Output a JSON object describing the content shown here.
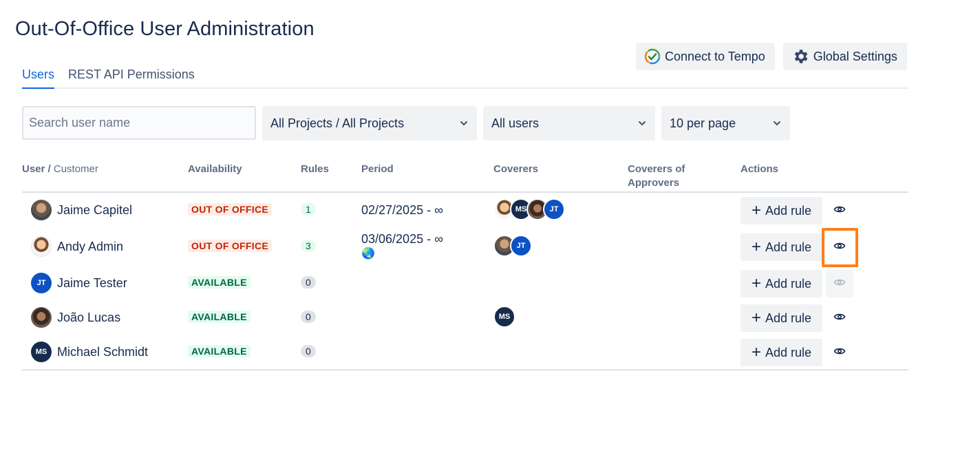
{
  "page": {
    "title": "Out-Of-Office User Administration"
  },
  "top_buttons": {
    "connect_tempo": "Connect to Tempo",
    "global_settings": "Global Settings"
  },
  "tabs": [
    {
      "label": "Users",
      "active": true
    },
    {
      "label": "REST API Permissions",
      "active": false
    }
  ],
  "filters": {
    "search_placeholder": "Search user name",
    "projects": "All Projects / All Projects",
    "users": "All users",
    "per_page": "10 per page"
  },
  "table": {
    "headers": {
      "user": "User /",
      "customer": "Customer",
      "availability": "Availability",
      "rules": "Rules",
      "period": "Period",
      "coverers": "Coverers",
      "coverers_approvers_line1": "Coverers of",
      "coverers_approvers_line2": "Approvers",
      "actions": "Actions"
    },
    "add_rule_label": "Add rule",
    "rows": [
      {
        "name": "Jaime Capitel",
        "availability": "OUT OF OFFICE",
        "rules": "1",
        "period": "02/27/2025 - ∞",
        "period_extra": "",
        "coverers": [
          "photo2",
          "MS",
          "photo3",
          "JT"
        ]
      },
      {
        "name": "Andy Admin",
        "availability": "OUT OF OFFICE",
        "rules": "3",
        "period": "03/06/2025 - ∞",
        "period_extra": "🌏",
        "coverers": [
          "photo1",
          "JT"
        ]
      },
      {
        "name": "Jaime Tester",
        "availability": "AVAILABLE",
        "rules": "0",
        "period": "",
        "period_extra": "",
        "coverers": []
      },
      {
        "name": "João Lucas",
        "availability": "AVAILABLE",
        "rules": "0",
        "period": "",
        "period_extra": "",
        "coverers": [
          "MS"
        ]
      },
      {
        "name": "Michael Schmidt",
        "availability": "AVAILABLE",
        "rules": "0",
        "period": "",
        "period_extra": "",
        "coverers": []
      }
    ],
    "initials": {
      "ms": "MS",
      "jt": "JT"
    }
  },
  "colors": {
    "accent": "#0c66e4",
    "highlight": "#ff7e1a"
  }
}
